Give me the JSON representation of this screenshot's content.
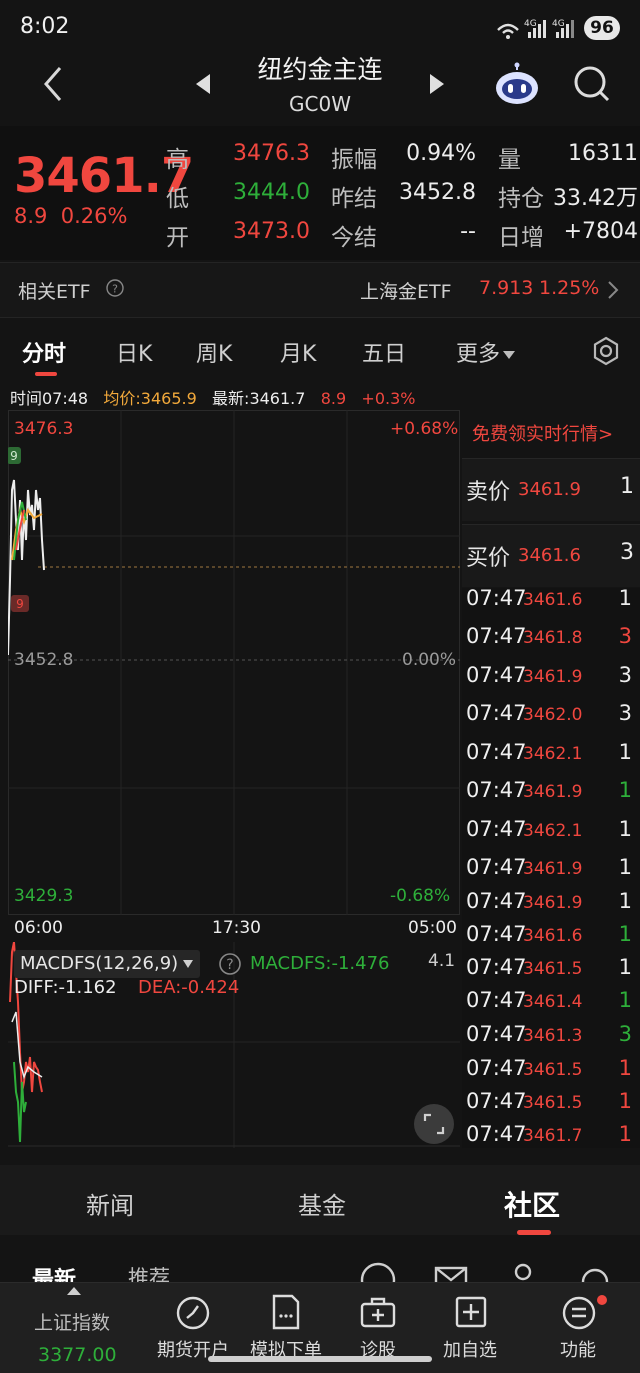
{
  "status": {
    "time": "8:02",
    "battery": "96",
    "network": "4G"
  },
  "nav": {
    "title": "纽约金主连",
    "code": "GC0W"
  },
  "quote": {
    "last": "3461.7",
    "change": "8.9",
    "change_pct": "0.26%",
    "high_label": "高",
    "high": "3476.3",
    "low_label": "低",
    "low": "3444.0",
    "open_label": "开",
    "open": "3473.0",
    "amp_label": "振幅",
    "amp": "0.94%",
    "prev_label": "昨结",
    "prev": "3452.8",
    "settle_label": "今结",
    "settle": "--",
    "vol_label": "量",
    "vol": "16311",
    "oi_label": "持仓",
    "oi": "33.42万",
    "daily_label": "日增",
    "daily": "+7804"
  },
  "etf": {
    "label": "相关ETF",
    "name": "上海金ETF",
    "price": "7.913",
    "pct": "1.25%"
  },
  "tabs": [
    "分时",
    "日K",
    "周K",
    "月K",
    "五日",
    "更多"
  ],
  "info": {
    "time_label": "时间07:48",
    "avg_label": "均价:3465.9",
    "latest_label": "最新:3461.7",
    "chg": "8.9",
    "pct": "+0.3%"
  },
  "chart": {
    "top_price": "3476.3",
    "top_pct": "+0.68%",
    "mid_price": "3452.8",
    "mid_pct": "0.00%",
    "bot_price": "3429.3",
    "bot_pct": "-0.68%",
    "x_start": "06:00",
    "x_mid": "17:30",
    "x_end": "05:00",
    "marker_high": "9",
    "marker_low": "9"
  },
  "macd": {
    "name": "MACDFS(12,26,9)",
    "value_label": "MACDFS:-1.476",
    "diff_label": "DIFF:-1.162",
    "dea_label": "DEA:-0.424",
    "scale": "4.1"
  },
  "orderbook": {
    "promo": "免费领实时行情>",
    "ask_label": "卖价",
    "ask_price": "3461.9",
    "ask_vol": "1",
    "bid_label": "买价",
    "bid_price": "3461.6",
    "bid_vol": "3",
    "trades": [
      {
        "time": "07:47",
        "price": "3461.6",
        "vol": "1",
        "color": "white"
      },
      {
        "time": "07:47",
        "price": "3461.8",
        "vol": "3",
        "color": "red"
      },
      {
        "time": "07:47",
        "price": "3461.9",
        "vol": "3",
        "color": "white"
      },
      {
        "time": "07:47",
        "price": "3462.0",
        "vol": "3",
        "color": "white"
      },
      {
        "time": "07:47",
        "price": "3462.1",
        "vol": "1",
        "color": "white"
      },
      {
        "time": "07:47",
        "price": "3461.9",
        "vol": "1",
        "color": "green"
      },
      {
        "time": "07:47",
        "price": "3462.1",
        "vol": "1",
        "color": "white"
      },
      {
        "time": "07:47",
        "price": "3461.9",
        "vol": "1",
        "color": "white"
      },
      {
        "time": "07:47",
        "price": "3461.9",
        "vol": "1",
        "color": "white"
      },
      {
        "time": "07:47",
        "price": "3461.6",
        "vol": "1",
        "color": "green"
      },
      {
        "time": "07:47",
        "price": "3461.5",
        "vol": "1",
        "color": "white"
      },
      {
        "time": "07:47",
        "price": "3461.4",
        "vol": "1",
        "color": "green"
      },
      {
        "time": "07:47",
        "price": "3461.3",
        "vol": "3",
        "color": "green"
      },
      {
        "time": "07:47",
        "price": "3461.5",
        "vol": "1",
        "color": "red"
      },
      {
        "time": "07:47",
        "price": "3461.5",
        "vol": "1",
        "color": "red"
      },
      {
        "time": "07:47",
        "price": "3461.7",
        "vol": "1",
        "color": "red"
      }
    ]
  },
  "section_tabs": [
    "新闻",
    "基金",
    "社区"
  ],
  "sub_tabs": [
    "最新",
    "推荐"
  ],
  "bottom": {
    "index_name": "上证指数",
    "index_value": "3377.00",
    "items": [
      "期货开户",
      "模拟下单",
      "诊股",
      "加自选",
      "功能"
    ]
  },
  "colors": {
    "red": "#f0473f",
    "green": "#2eaf3a",
    "orange": "#f2a93b",
    "bg": "#141414"
  }
}
